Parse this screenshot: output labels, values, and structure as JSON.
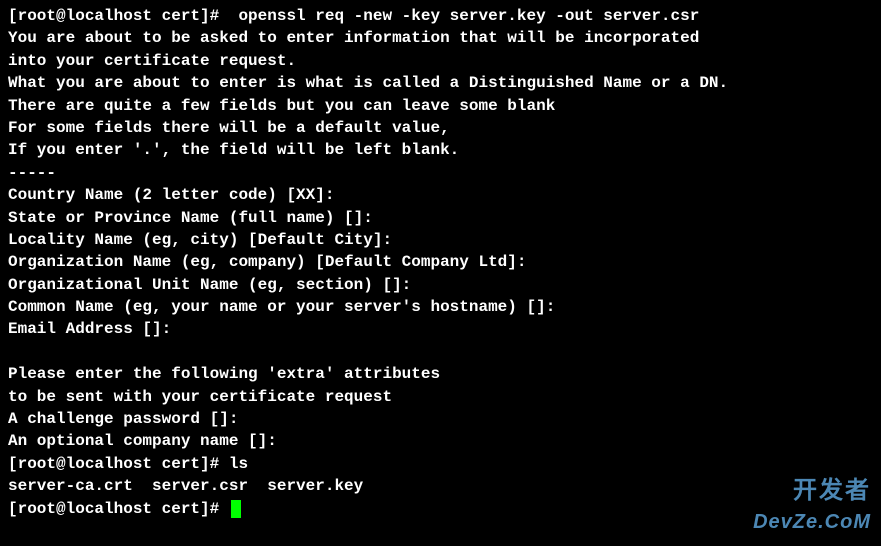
{
  "lines": [
    {
      "prompt": "[root@localhost cert]# ",
      "command": " openssl req -new -key server.key -out server.csr"
    },
    {
      "text": "You are about to be asked to enter information that will be incorporated"
    },
    {
      "text": "into your certificate request."
    },
    {
      "text": "What you are about to enter is what is called a Distinguished Name or a DN."
    },
    {
      "text": "There are quite a few fields but you can leave some blank"
    },
    {
      "text": "For some fields there will be a default value,"
    },
    {
      "text": "If you enter '.', the field will be left blank."
    },
    {
      "text": "-----"
    },
    {
      "text": "Country Name (2 letter code) [XX]:"
    },
    {
      "text": "State or Province Name (full name) []:"
    },
    {
      "text": "Locality Name (eg, city) [Default City]:"
    },
    {
      "text": "Organization Name (eg, company) [Default Company Ltd]:"
    },
    {
      "text": "Organizational Unit Name (eg, section) []:"
    },
    {
      "text": "Common Name (eg, your name or your server's hostname) []:"
    },
    {
      "text": "Email Address []:"
    },
    {
      "text": ""
    },
    {
      "text": "Please enter the following 'extra' attributes"
    },
    {
      "text": "to be sent with your certificate request"
    },
    {
      "text": "A challenge password []:"
    },
    {
      "text": "An optional company name []:"
    },
    {
      "prompt": "[root@localhost cert]# ",
      "command": "ls"
    },
    {
      "text": "server-ca.crt  server.csr  server.key"
    },
    {
      "prompt": "[root@localhost cert]# ",
      "cursor": true
    }
  ],
  "watermark": {
    "cn": "开发者",
    "en": "DevZe.CoM"
  }
}
